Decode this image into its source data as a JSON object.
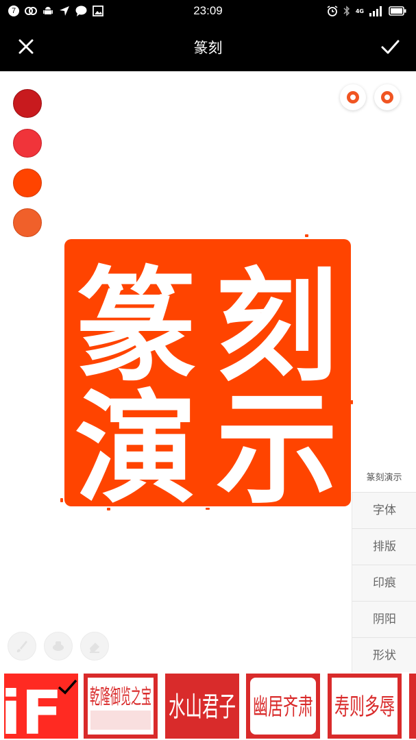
{
  "status_bar": {
    "time": "23:09",
    "notification_badge": "7",
    "network_label": "4G",
    "icons": [
      "notification-count-icon",
      "link-icon",
      "android-icon",
      "location-arrow-icon",
      "chat-bubble-icon",
      "image-icon",
      "alarm-icon",
      "bluetooth-icon",
      "signal-icon",
      "battery-icon"
    ]
  },
  "app_bar": {
    "title": "篆刻",
    "close_icon": "close-icon",
    "confirm_icon": "check-icon"
  },
  "color_swatches": [
    "#c81a1e",
    "#f0343a",
    "#ff4400",
    "#f0602a"
  ],
  "seal": {
    "text": "篆刻演示",
    "characters": [
      "篆",
      "刻",
      "演",
      "示"
    ],
    "background_color": "#ff4400",
    "text_color": "#ffffff"
  },
  "side_panel": {
    "preview_label": "篆刻演示",
    "menu": [
      {
        "label": "字体"
      },
      {
        "label": "排版"
      },
      {
        "label": "印痕"
      },
      {
        "label": "阴阳"
      },
      {
        "label": "形状"
      }
    ]
  },
  "tools": [
    "brush-icon",
    "smudge-icon",
    "eraser-icon"
  ],
  "templates": [
    {
      "name": "iF",
      "text": "iF",
      "selected": true
    },
    {
      "text": "乾隆御览之宝"
    },
    {
      "text": "水山君子"
    },
    {
      "text": "幽居齐肃"
    },
    {
      "text": "寿则多辱"
    }
  ]
}
